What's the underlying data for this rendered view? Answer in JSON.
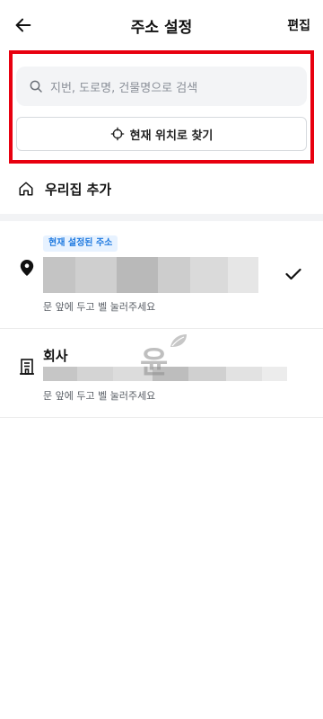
{
  "header": {
    "title": "주소 설정",
    "edit_label": "편집",
    "back_icon": "arrow-left-icon"
  },
  "search": {
    "placeholder": "지번, 도로명, 건물명으로 검색",
    "locate_label": "현재 위치로 찾기",
    "highlight_color": "#e8000f"
  },
  "home": {
    "label": "우리집 추가",
    "icon": "home-icon"
  },
  "addresses": [
    {
      "badge": "현재 설정된 주소",
      "icon": "location-pin-icon",
      "note": "문 앞에 두고 벨 눌러주세요",
      "selected": true
    },
    {
      "name": "회사",
      "icon": "building-icon",
      "note": "문 앞에 두고 벨 눌러주세요",
      "selected": false
    }
  ],
  "watermark": {
    "text": "윤"
  },
  "colors": {
    "badge_bg": "#e7f2ff",
    "badge_text": "#1f7ae0",
    "divider": "#f2f3f5"
  }
}
